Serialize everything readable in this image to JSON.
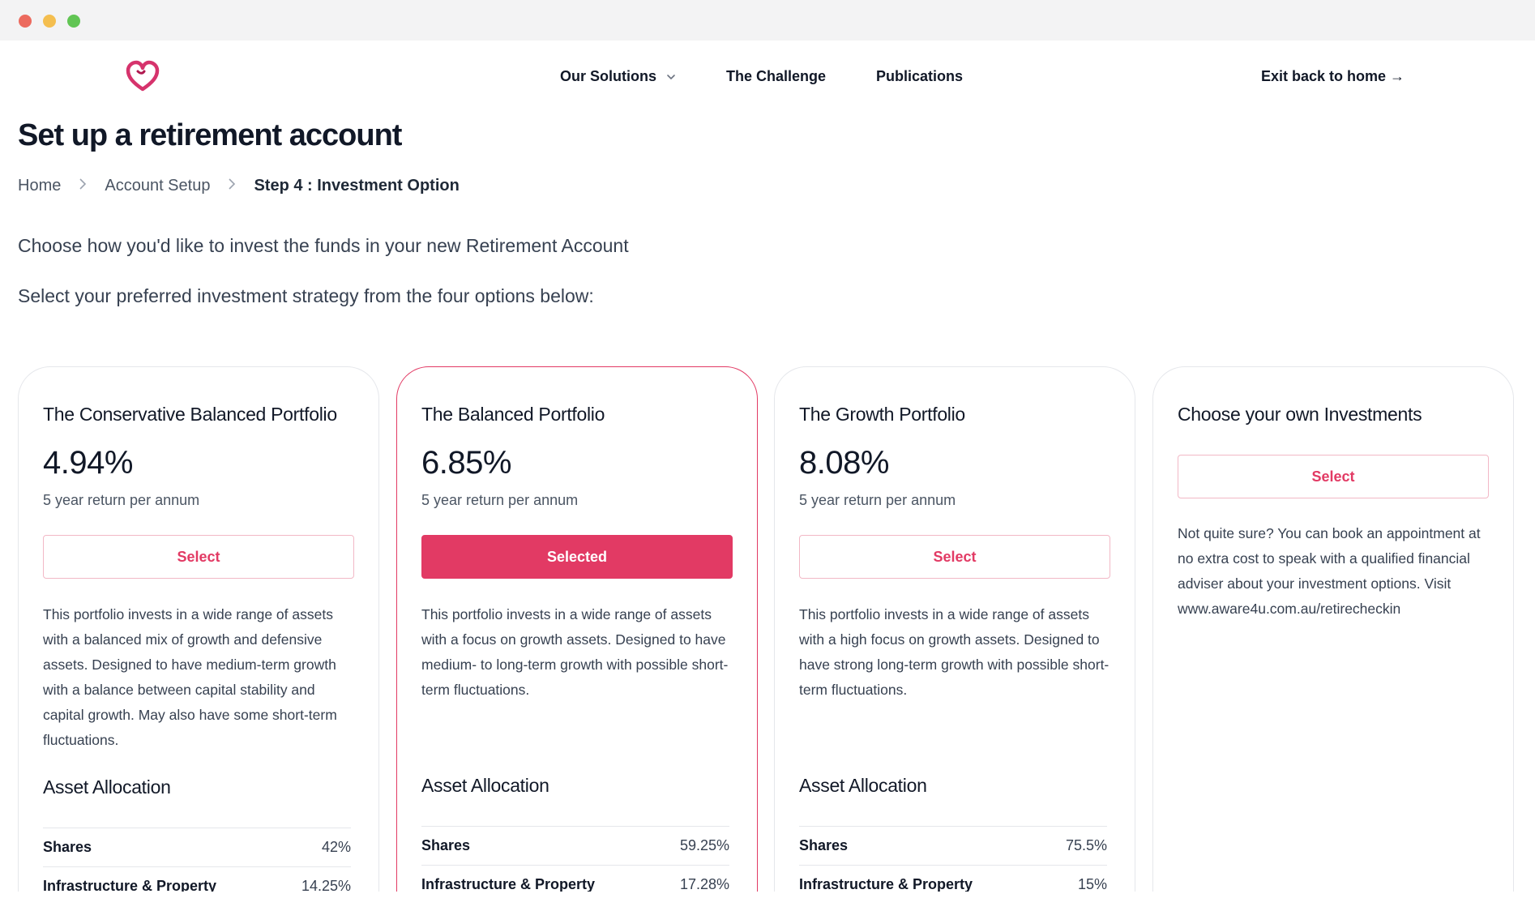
{
  "window": {
    "controls": [
      "close",
      "minimize",
      "maximize"
    ]
  },
  "header": {
    "logo_icon": "heart-logo-icon",
    "nav": [
      {
        "label": "Our Solutions",
        "has_dropdown": true
      },
      {
        "label": "The Challenge",
        "has_dropdown": false
      },
      {
        "label": "Publications",
        "has_dropdown": false
      }
    ],
    "exit_label": "Exit back to home →"
  },
  "page": {
    "title": "Set up a retirement account",
    "breadcrumb": [
      "Home",
      "Account Setup",
      "Step 4 : Investment Option"
    ],
    "intro": "Choose how you'd like to invest the funds in your new Retirement Account",
    "instruction": "Select your preferred investment strategy from the four options below:"
  },
  "cards": [
    {
      "title": "The Conservative Balanced Portfolio",
      "rate": "4.94%",
      "rate_label": "5 year return per annum",
      "button": "Select",
      "selected": false,
      "description": "This portfolio invests in a wide range of assets with a balanced mix of growth and defensive assets. Designed to have medium-term growth with a balance between capital stability and capital growth. May also have some short-term fluctuations.",
      "allocation_title": "Asset Allocation",
      "allocation": [
        {
          "name": "Shares",
          "value": "42%"
        },
        {
          "name": "Infrastructure & Property",
          "value": "14.25%"
        }
      ]
    },
    {
      "title": "The Balanced Portfolio",
      "rate": "6.85%",
      "rate_label": "5 year return per annum",
      "button": "Selected",
      "selected": true,
      "description": "This portfolio invests in a wide range of assets with a focus on growth assets. Designed to have medium- to long-term growth with possible short-term fluctuations.",
      "allocation_title": "Asset Allocation",
      "allocation": [
        {
          "name": "Shares",
          "value": "59.25%"
        },
        {
          "name": "Infrastructure & Property",
          "value": "17.28%"
        }
      ]
    },
    {
      "title": "The Growth Portfolio",
      "rate": "8.08%",
      "rate_label": "5 year return per annum",
      "button": "Select",
      "selected": false,
      "description": "This portfolio invests in a wide range of assets with a high focus on growth assets. Designed to have strong long-term growth with possible short-term fluctuations.",
      "allocation_title": "Asset Allocation",
      "allocation": [
        {
          "name": "Shares",
          "value": "75.5%"
        },
        {
          "name": "Infrastructure & Property",
          "value": "15%"
        }
      ]
    },
    {
      "title": "Choose your own Investments",
      "button": "Select",
      "selected": false,
      "description": "Not quite sure? You can book an appointment at no extra cost to speak with a qualified financial adviser about your investment options. Visit www.aware4u.com.au/retirecheckin"
    }
  ],
  "colors": {
    "accent": "#e23a64",
    "text": "#111827",
    "muted": "#4b5563",
    "border": "#e5e7eb"
  }
}
